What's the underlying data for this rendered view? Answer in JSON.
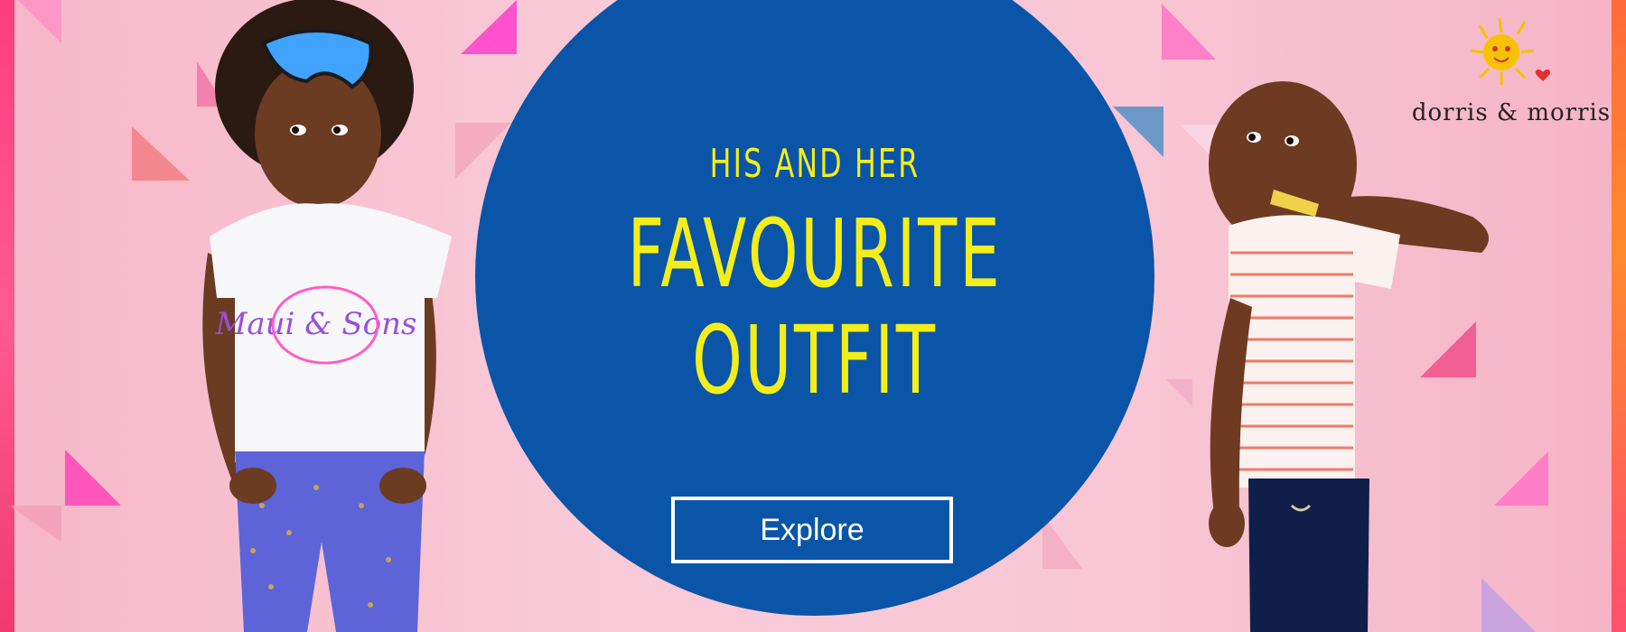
{
  "headline": {
    "sub": "HIS AND HER",
    "line1": "FAVOURITE",
    "line2": "OUTFIT"
  },
  "cta": {
    "label": "Explore"
  },
  "brand": {
    "logo_text": "dorris & morris"
  },
  "shirt_print": {
    "text": "Maui & Sons"
  },
  "colors": {
    "circle": "#0a55a8",
    "headline": "#f3ee1b",
    "background": "#f8c6d4",
    "accent_pink": "#ff3d9a"
  },
  "icons": {
    "logo": "sun-icon",
    "heart": "heart-icon"
  }
}
